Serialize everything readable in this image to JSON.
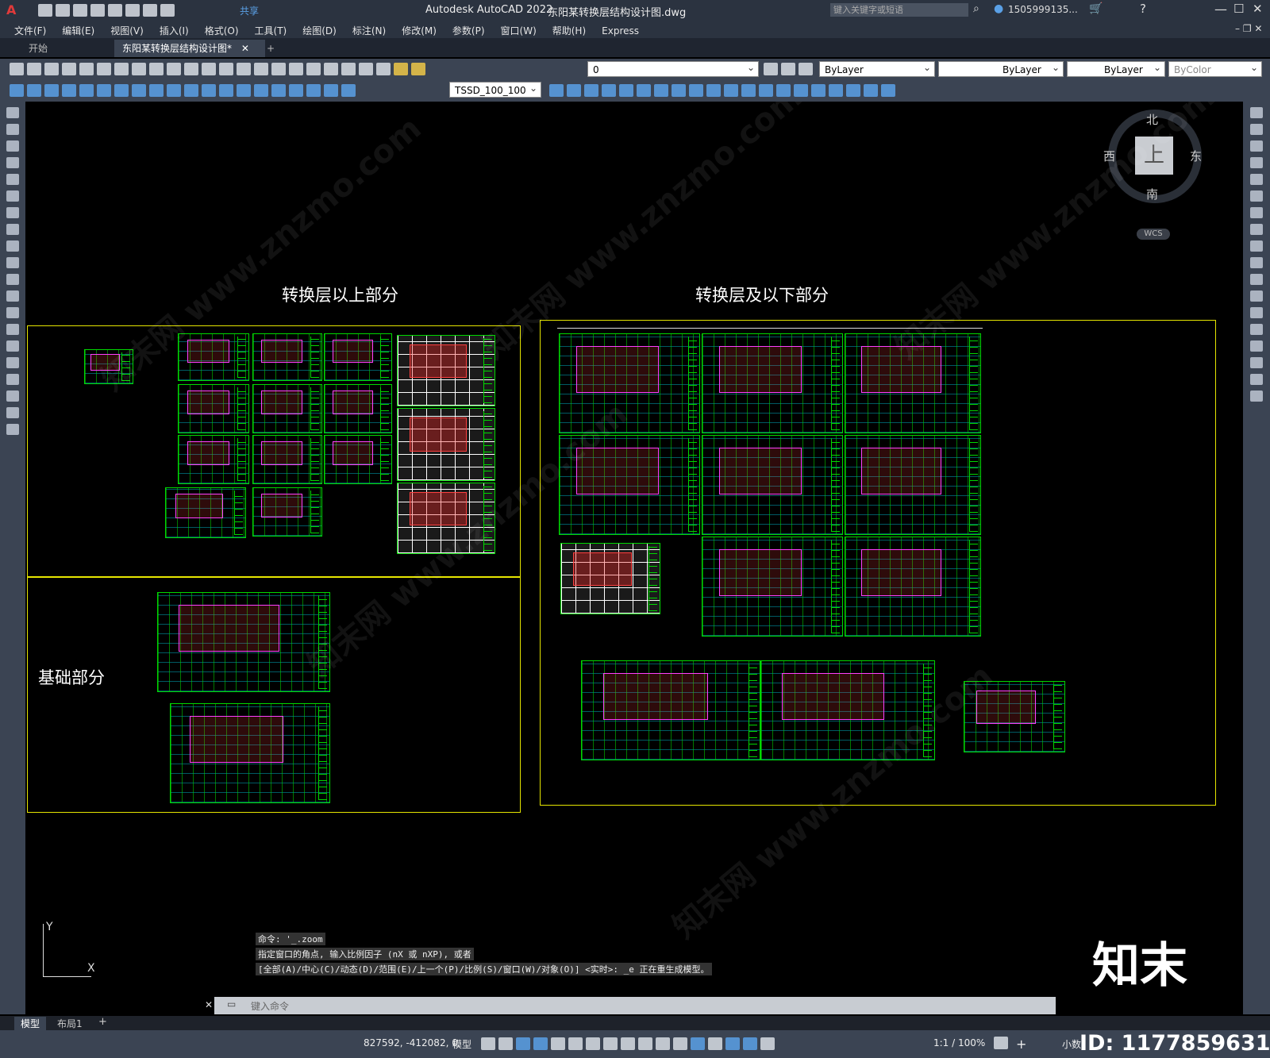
{
  "app": {
    "logo": "A",
    "title": "Autodesk AutoCAD 2022",
    "filename": "东阳某转换层结构设计图.dwg",
    "share": "共享"
  },
  "search": {
    "placeholder": "键入关键字或短语"
  },
  "user": {
    "name": "1505999135..."
  },
  "menu": [
    "文件(F)",
    "编辑(E)",
    "视图(V)",
    "插入(I)",
    "格式(O)",
    "工具(T)",
    "绘图(D)",
    "标注(N)",
    "修改(M)",
    "参数(P)",
    "窗口(W)",
    "帮助(H)",
    "Express"
  ],
  "tabs": {
    "start": "开始",
    "active": "东阳某转换层结构设计图*",
    "close": "✕",
    "add": "+"
  },
  "toolbar": {
    "layer": "0",
    "color": "ByLayer",
    "linetype": "ByLayer",
    "lineweight": "ByLayer",
    "plotstyle": "ByColor",
    "dimstyle": "TSSD_100_100"
  },
  "viewcube": {
    "north": "北",
    "south": "南",
    "west": "西",
    "east": "东",
    "top": "上",
    "wcs": "WCS"
  },
  "drawing": {
    "label_upper": "转换层以上部分",
    "label_lower": "转换层及以下部分",
    "label_foundation": "基础部分"
  },
  "ucs": {
    "x": "X",
    "y": "Y"
  },
  "command": {
    "history": [
      "命令: '_.zoom",
      "指定窗口的角点, 输入比例因子 (nX 或 nXP), 或者",
      "[全部(A)/中心(C)/动态(D)/范围(E)/上一个(P)/比例(S)/窗口(W)/对象(O)] <实时>: _e 正在重生成模型。"
    ],
    "placeholder": "键入命令"
  },
  "layouts": {
    "model": "模型",
    "layout1": "布局1",
    "add": "+"
  },
  "status": {
    "coords": "827592, -412082, 0",
    "mode": "模型",
    "scale": "1:1 / 100%",
    "units": "小数"
  },
  "watermark": {
    "brand": "知末",
    "id": "ID: 1177859631",
    "site": "知末网 www.znzmo.com"
  },
  "colors": {
    "sheet": "#00d800",
    "frame": "#e6e600",
    "accent": "#5aa0e6"
  }
}
